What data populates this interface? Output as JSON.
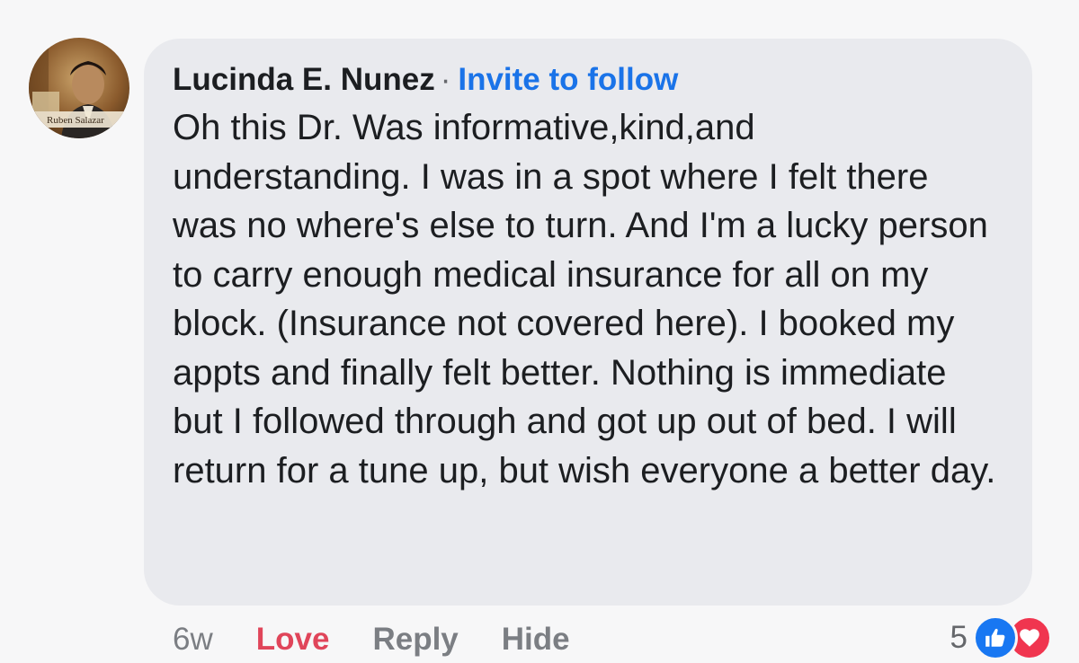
{
  "comment": {
    "author": "Lucinda E. Nunez",
    "separator": "·",
    "invite_label": "Invite to follow",
    "text": "Oh this Dr. Was informative,kind,and understanding. I was in a spot where I felt there was no where's else to turn. And I'm a lucky person to carry enough medical insurance for all on my block. (Insurance not covered here). I booked my appts and finally felt better. Nothing is immediate but I followed through and got up out of bed. I will return for a tune up, but wish everyone a better day."
  },
  "avatar": {
    "caption": "Ruben Salazar"
  },
  "actions": {
    "time": "6w",
    "love_label": "Love",
    "reply_label": "Reply",
    "hide_label": "Hide"
  },
  "reactions": {
    "count": "5",
    "icons": [
      "like-icon",
      "heart-icon"
    ]
  },
  "colors": {
    "link": "#1a73e8",
    "love": "#e0455a",
    "like": "#1877f2",
    "heart": "#f0354f",
    "bubble": "#e9eaee"
  }
}
